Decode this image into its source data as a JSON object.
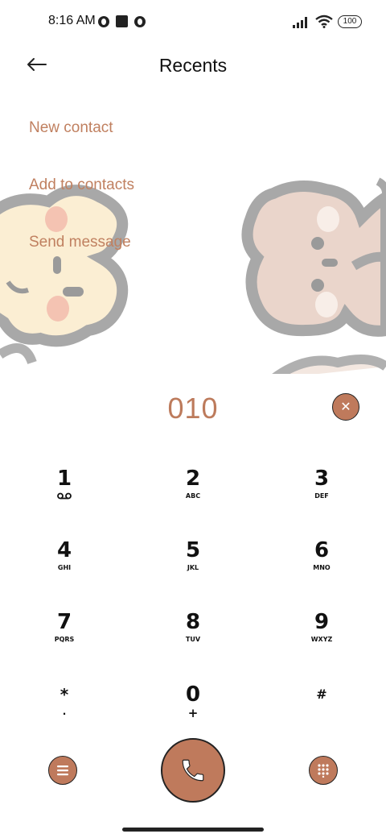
{
  "status_bar": {
    "time": "8:16 AM",
    "battery": "100",
    "icons": [
      "notification-icon",
      "stop-icon",
      "notification-icon",
      "signal-icon",
      "wifi-icon",
      "battery-icon"
    ]
  },
  "header": {
    "title": "Recents",
    "back_icon": "arrow-left-icon"
  },
  "options": {
    "new_contact": "New contact",
    "add_to_contacts": "Add to contacts",
    "send_message": "Send message"
  },
  "dialer": {
    "number": "010",
    "clear_icon": "close-icon",
    "keys": [
      {
        "digit": "1",
        "letters": "∞"
      },
      {
        "digit": "2",
        "letters": "ABC"
      },
      {
        "digit": "3",
        "letters": "DEF"
      },
      {
        "digit": "4",
        "letters": "GHI"
      },
      {
        "digit": "5",
        "letters": "JKL"
      },
      {
        "digit": "6",
        "letters": "MNO"
      },
      {
        "digit": "7",
        "letters": "PQRS"
      },
      {
        "digit": "8",
        "letters": "TUV"
      },
      {
        "digit": "9",
        "letters": "WXYZ"
      },
      {
        "digit": "*",
        "letters": "·"
      },
      {
        "digit": "0",
        "letters": "+"
      },
      {
        "digit": "#",
        "letters": ""
      }
    ],
    "accent_color": "#bf7a5c"
  }
}
